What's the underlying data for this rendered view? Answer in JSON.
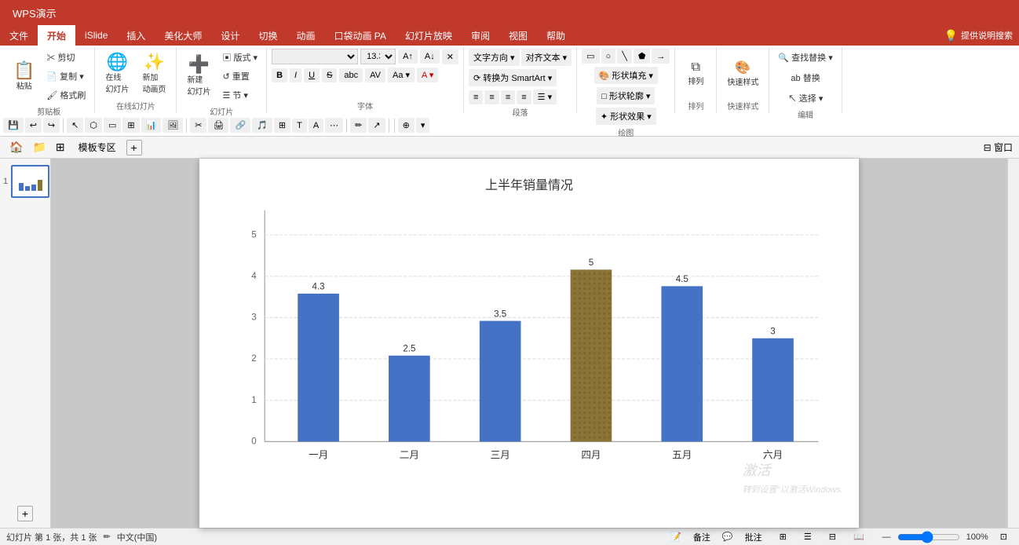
{
  "app": {
    "title": "WPS演示",
    "windowControls": [
      "minimize",
      "maximize",
      "close"
    ]
  },
  "ribbon": {
    "tabs": [
      "文件",
      "开始",
      "iSlide",
      "插入",
      "美化大师",
      "设计",
      "切换",
      "动画",
      "口袋动画 PA",
      "幻灯片放映",
      "审阅",
      "视图",
      "帮助"
    ],
    "activeTab": "开始",
    "groups": [
      {
        "name": "剪贴板",
        "buttons": [
          "粘贴",
          "剪切",
          "复制",
          "格式刷"
        ]
      },
      {
        "name": "在线幻灯片",
        "buttons": [
          "在线幻灯片",
          "新加动画页"
        ]
      },
      {
        "name": "幻灯片",
        "buttons": [
          "新建幻灯片",
          "版式",
          "重置",
          "节"
        ]
      },
      {
        "name": "字体",
        "buttons": [
          "B",
          "I",
          "U",
          "S",
          "A"
        ]
      },
      {
        "name": "段落",
        "buttons": [
          "左对齐",
          "居中",
          "右对齐"
        ]
      },
      {
        "name": "绘图",
        "buttons": [
          "形状"
        ]
      },
      {
        "name": "排列",
        "buttons": [
          "排列"
        ]
      },
      {
        "name": "快速样式",
        "buttons": [
          "快速样式"
        ]
      },
      {
        "name": "编辑",
        "buttons": [
          "查找替换",
          "选择"
        ]
      }
    ]
  },
  "formatBar": {
    "tools": [
      "save",
      "undo",
      "redo",
      "cursor",
      "shapes",
      "frames",
      "charts",
      "images",
      "draw"
    ]
  },
  "navBar": {
    "home": "模板专区",
    "add": "+"
  },
  "chart": {
    "title": "上半年销量情况",
    "bars": [
      {
        "month": "一月",
        "value": 4.3,
        "color": "#4472c4",
        "highlighted": false
      },
      {
        "month": "二月",
        "value": 2.5,
        "color": "#4472c4",
        "highlighted": false
      },
      {
        "month": "三月",
        "value": 3.5,
        "color": "#4472c4",
        "highlighted": false
      },
      {
        "month": "四月",
        "value": 5.0,
        "color": "#8b7536",
        "highlighted": true
      },
      {
        "month": "五月",
        "value": 4.5,
        "color": "#4472c4",
        "highlighted": false
      },
      {
        "month": "六月",
        "value": 3.0,
        "color": "#4472c4",
        "highlighted": false
      }
    ],
    "maxValue": 6
  },
  "statusBar": {
    "slideInfo": "幻灯片 第 1 张，共 1 张",
    "language": "中文(中国)",
    "notes": "备注",
    "comments": "批注",
    "watermark": "激活"
  }
}
